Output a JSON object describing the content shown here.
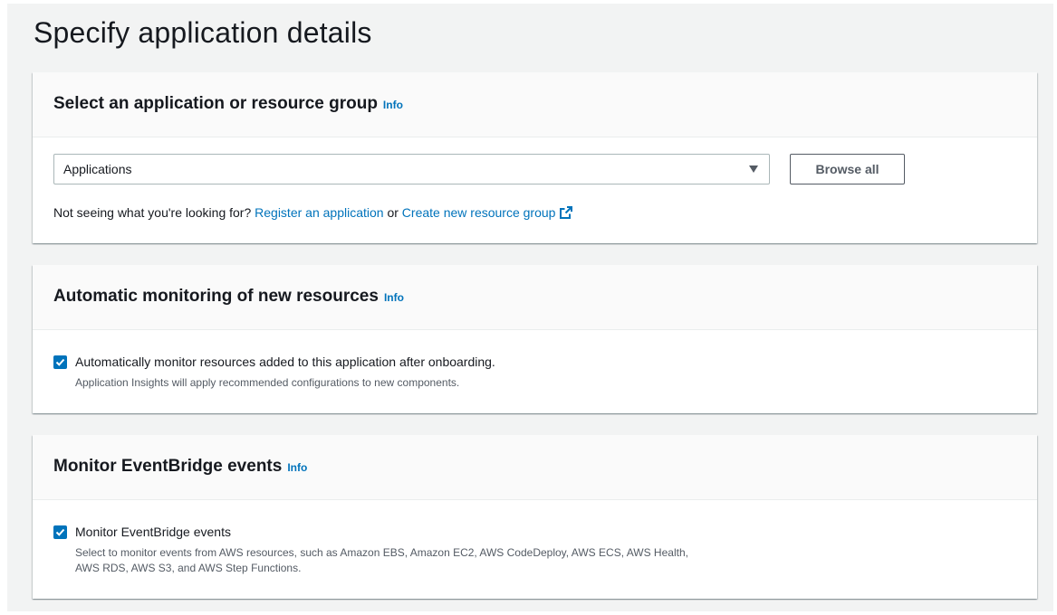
{
  "page": {
    "title": "Specify application details"
  },
  "sections": {
    "select_group": {
      "title": "Select an application or resource group",
      "info": "Info",
      "select_value": "Applications",
      "browse_button": "Browse all",
      "helper_prefix": "Not seeing what you're looking for?",
      "register_link": "Register an application",
      "or": "or",
      "create_link": "Create new resource group"
    },
    "auto_monitoring": {
      "title": "Automatic monitoring of new resources",
      "info": "Info",
      "checkbox_checked": true,
      "checkbox_label": "Automatically monitor resources added to this application after onboarding.",
      "checkbox_description": "Application Insights will apply recommended configurations to new components."
    },
    "eventbridge": {
      "title": "Monitor EventBridge events",
      "info": "Info",
      "checkbox_checked": true,
      "checkbox_label": "Monitor EventBridge events",
      "checkbox_description_line1": "Select to monitor events from AWS resources, such as Amazon EBS, Amazon EC2, AWS CodeDeploy, AWS ECS, AWS Health,",
      "checkbox_description_line2": "AWS RDS, AWS S3, and AWS Step Functions."
    }
  },
  "colors": {
    "accent": "#0073bb",
    "page_bg": "#f2f3f3",
    "text": "#16191f"
  },
  "icons": {
    "checkbox": "checkmark-icon",
    "dropdown": "caret-down-icon",
    "external": "external-link-icon"
  }
}
